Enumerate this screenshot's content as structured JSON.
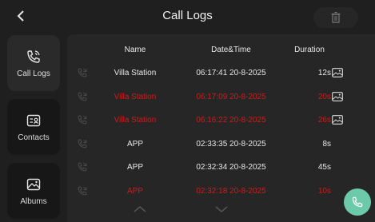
{
  "header": {
    "title": "Call Logs"
  },
  "sidebar": {
    "items": [
      {
        "label": "Call Logs",
        "icon": "phone-ring-icon"
      },
      {
        "label": "Contacts",
        "icon": "contacts-icon"
      },
      {
        "label": "Albums",
        "icon": "image-icon"
      }
    ]
  },
  "table": {
    "columns": [
      "Name",
      "Date&Time",
      "Duration"
    ],
    "rows": [
      {
        "name": "Villa Station",
        "datetime": "06:17:41 20-8-2025",
        "duration": "12s",
        "missed": false,
        "has_image": true
      },
      {
        "name": "Villa Station",
        "datetime": "06:17:09 20-8-2025",
        "duration": "20s",
        "missed": true,
        "has_image": true
      },
      {
        "name": "Villa Station",
        "datetime": "06:16:22 20-8-2025",
        "duration": "26s",
        "missed": true,
        "has_image": true
      },
      {
        "name": "APP",
        "datetime": "02:33:35 20-8-2025",
        "duration": "8s",
        "missed": false,
        "has_image": false
      },
      {
        "name": "APP",
        "datetime": "02:32:34 20-8-2025",
        "duration": "45s",
        "missed": false,
        "has_image": false
      },
      {
        "name": "APP",
        "datetime": "02:32:18 20-8-2025",
        "duration": "10s",
        "missed": true,
        "has_image": false
      }
    ]
  },
  "colors": {
    "missed": "#d01a1a",
    "accent": "#6cc9a9",
    "background": "#1f1f1f",
    "panel": "#262626"
  }
}
